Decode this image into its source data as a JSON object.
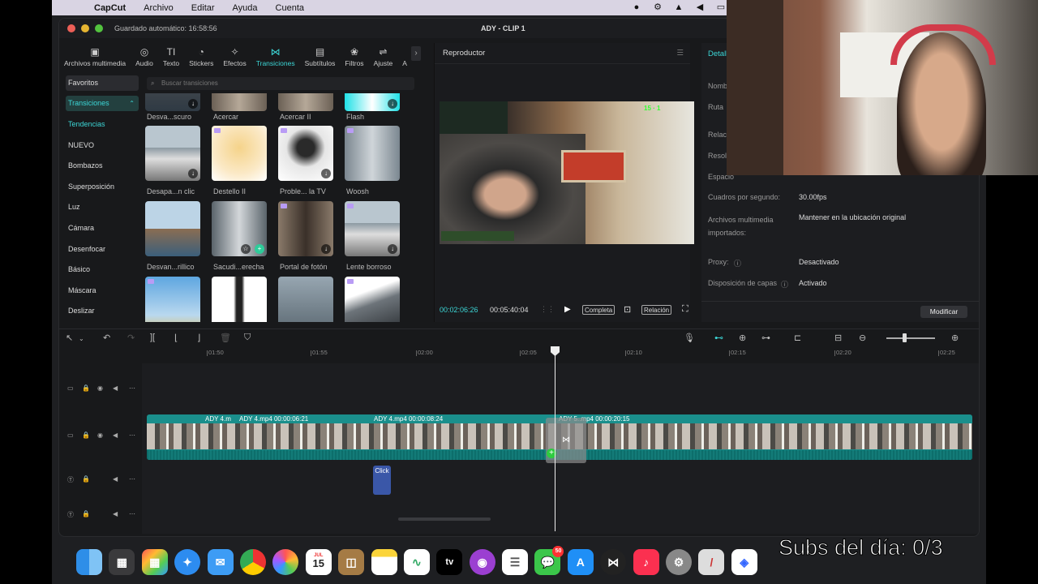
{
  "menubar": {
    "app": "CapCut",
    "items": [
      "Archivo",
      "Editar",
      "Ayuda",
      "Cuenta"
    ]
  },
  "window": {
    "autosave": "Guardado automático: 16:58:56",
    "title": "ADY - CLIP 1"
  },
  "toolbar": {
    "items": [
      {
        "label": "Archivos multimedia",
        "icon": "▣"
      },
      {
        "label": "Audio",
        "icon": "◎"
      },
      {
        "label": "Texto",
        "icon": "TI"
      },
      {
        "label": "Stickers",
        "icon": "◔"
      },
      {
        "label": "Efectos",
        "icon": "✧"
      },
      {
        "label": "Transiciones",
        "icon": "⋈"
      },
      {
        "label": "Subtítulos",
        "icon": "▤"
      },
      {
        "label": "Filtros",
        "icon": "❀"
      },
      {
        "label": "Ajuste",
        "icon": "⇌"
      },
      {
        "label": "A",
        "icon": ""
      }
    ],
    "more": "›"
  },
  "leftnav": {
    "favoritos": "Favoritos",
    "transiciones": "Transiciones",
    "items": [
      "Tendencias",
      "NUEVO",
      "Bombazos",
      "Superposición",
      "Luz",
      "Cámara",
      "Desenfocar",
      "Básico",
      "Máscara",
      "Deslizar"
    ]
  },
  "search": {
    "placeholder": "Buscar transiciones"
  },
  "thumbs": {
    "row1": [
      "Desva...scuro",
      "Acercar",
      "Acercar II",
      "Flash"
    ],
    "row2": [
      "Desapa...n clic",
      "Destello II",
      "Proble... la TV",
      "Woosh"
    ],
    "row3": [
      "Desvan...rillico",
      "Sacudi...erecha",
      "Portal de fotón",
      "Lente borroso"
    ]
  },
  "player": {
    "title": "Reproductor",
    "time_current": "00:02:06:26",
    "time_total": "00:05:40:04",
    "btn_full": "Completa",
    "btn_ratio": "Relación",
    "overlay_counts": "15 · 1"
  },
  "details": {
    "tab": "Detalle",
    "labels": {
      "nombre": "Nombre",
      "ruta": "Ruta",
      "relacion": "Relació",
      "resolucion": "Resolu",
      "espacio": "Espacio",
      "fps": "Cuadros por segundo:",
      "importados": "Archivos multimedia importados:",
      "proxy": "Proxy:",
      "capas": "Disposición de capas"
    },
    "values": {
      "fps": "30.00fps",
      "importados": "Mantener en la ubicación original",
      "proxy": "Desactivado",
      "capas": "Activado"
    },
    "button": "Modificar"
  },
  "ruler": {
    "ticks": [
      "01:50",
      "01:55",
      "02:00",
      "02:05",
      "02:10",
      "02:15",
      "02:20",
      "02:25"
    ]
  },
  "timeline": {
    "clips": [
      {
        "label": "ADY 4.m"
      },
      {
        "label": "ADY 4.mp4   00:00:06:21"
      },
      {
        "label": "ADY 4.mp4   00:00:08:24"
      },
      {
        "label": "ADY 5..mp4   00:00:20:15"
      }
    ],
    "text_clip": "Click"
  },
  "dock": {
    "calendar_day": "15",
    "calendar_month": "JUL",
    "messages_badge": "50",
    "tv_label": "tv"
  },
  "overlay": {
    "subs_text": "Subs del día: 0/3"
  },
  "colors": {
    "accent": "#3cd6d6",
    "clip": "#1a8f8c",
    "text_clip": "#3a57a8"
  }
}
